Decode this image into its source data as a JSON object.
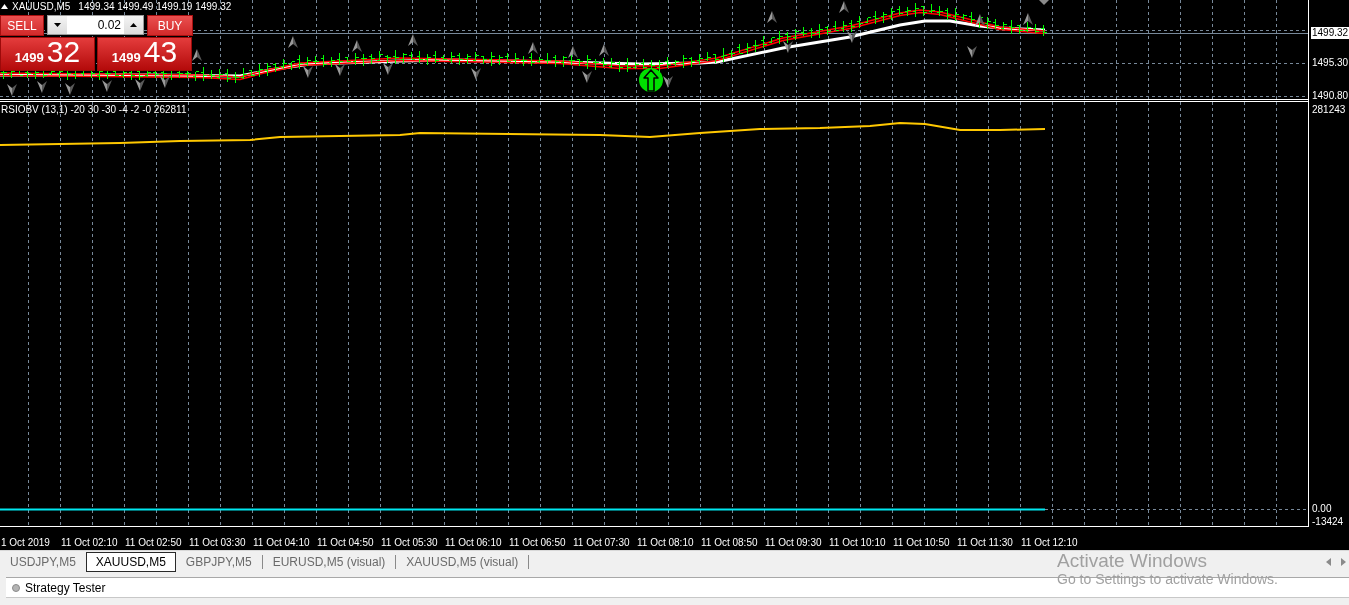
{
  "chart": {
    "symbol": "XAUUSD,M5",
    "quote": "1499.34 1499.49 1499.19 1499.32",
    "indicator_label": "RSIOBV (13,1) -20 30 -30 -4 -2 -0 262811"
  },
  "trade_panel": {
    "sell_label": "SELL",
    "buy_label": "BUY",
    "lot": "0.02",
    "sell_price": {
      "big_figure": "1499",
      "pips": "32"
    },
    "buy_price": {
      "big_figure": "1499",
      "pips": "43"
    }
  },
  "price_axis": [
    {
      "label": "1499.32",
      "kind": "current"
    },
    {
      "label": "1495.30",
      "kind": "tick"
    },
    {
      "label": "1490.80",
      "kind": "tick"
    }
  ],
  "indicator_axis": [
    {
      "label": "281243"
    },
    {
      "label": "0.00"
    },
    {
      "label": "-13424"
    }
  ],
  "time_axis": [
    "1 Oct 2019",
    "11 Oct 02:10",
    "11 Oct 02:50",
    "11 Oct 03:30",
    "11 Oct 04:10",
    "11 Oct 04:50",
    "11 Oct 05:30",
    "11 Oct 06:10",
    "11 Oct 06:50",
    "11 Oct 07:30",
    "11 Oct 08:10",
    "11 Oct 08:50",
    "11 Oct 09:30",
    "11 Oct 10:10",
    "11 Oct 10:50",
    "11 Oct 11:30",
    "11 Oct 12:10"
  ],
  "chart_tabs": [
    {
      "label": "USDJPY,M5",
      "selected": false
    },
    {
      "label": "XAUUSD,M5",
      "selected": true
    },
    {
      "label": "GBPJPY,M5",
      "selected": false
    },
    {
      "label": "EURUSD,M5 (visual)",
      "selected": false
    },
    {
      "label": "XAUUSD,M5 (visual)",
      "selected": false
    }
  ],
  "tester_panel": {
    "title": "Strategy Tester"
  },
  "activation_notice": {
    "title": "Activate Windows",
    "message": "Go to Settings to activate Windows."
  }
}
